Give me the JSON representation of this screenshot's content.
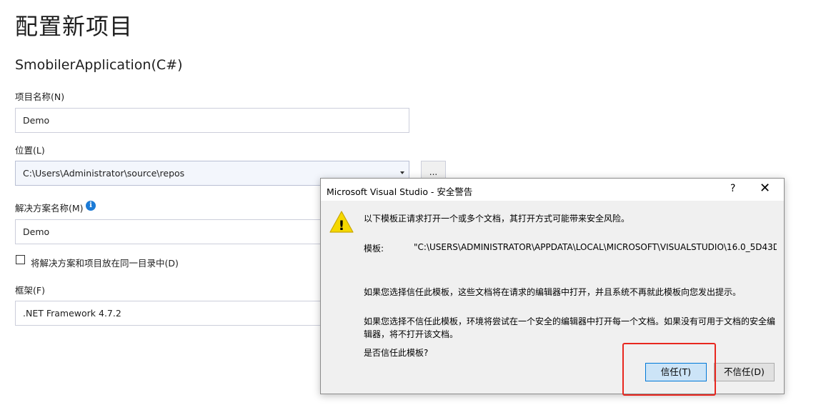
{
  "page": {
    "title": "配置新项目",
    "template_name": "SmobilerApplication(C#)"
  },
  "form": {
    "project_name": {
      "label": "项目名称(N)",
      "value": "Demo"
    },
    "location": {
      "label": "位置(L)",
      "value": "C:\\Users\\Administrator\\source\\repos",
      "browse_label": "..."
    },
    "solution_name": {
      "label": "解决方案名称(M)",
      "value": "Demo",
      "info_glyph": "i"
    },
    "same_dir_checkbox": {
      "label": "将解决方案和项目放在同一目录中(D)",
      "checked": false
    },
    "framework": {
      "label": "框架(F)",
      "value": ".NET Framework 4.7.2"
    }
  },
  "dialog": {
    "title": "Microsoft Visual Studio - 安全警告",
    "help_glyph": "?",
    "close_glyph": "✕",
    "warning_icon": "warning-icon",
    "warning_glyph": "!",
    "message_intro": "以下模板正请求打开一个或多个文档，其打开方式可能带来安全风险。",
    "template_label": "模板:",
    "template_path": "\"C:\\USERS\\ADMINISTRATOR\\APPDATA\\LOCAL\\MICROSOFT\\VISUALSTUDIO\\16.0_5D43D",
    "trust_info": "如果您选择信任此模板，这些文档将在请求的编辑器中打开，并且系统不再就此模板向您发出提示。",
    "distrust_info_line1": "如果您选择不信任此模板，环境将尝试在一个安全的编辑器中打开每一个文档。如果没有可用于文档的安全编",
    "distrust_info_line2": "辑器，将不打开该文档。",
    "question": "是否信任此模板?",
    "trust_button": "信任(T)",
    "distrust_button": "不信任(D)"
  },
  "colors": {
    "accent": "#0078d7",
    "highlight": "#e8271f",
    "warning": "#f5d800"
  }
}
